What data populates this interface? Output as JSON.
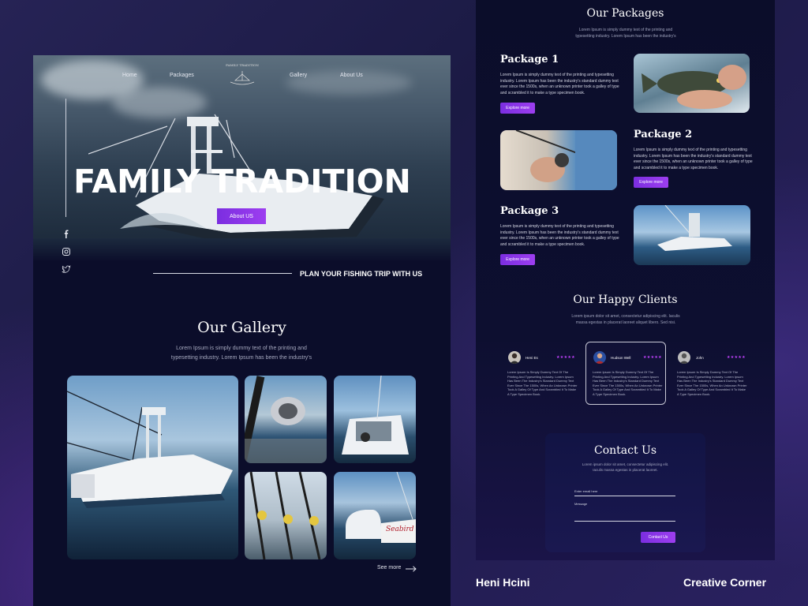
{
  "nav": {
    "home": "Home",
    "packages": "Packages",
    "gallery": "Gallery",
    "about": "About Us",
    "logo_text": "FAMILY TRADITION"
  },
  "hero": {
    "title": "FAMILY TRADITION",
    "button": "About US",
    "plan_text": "PLAN YOUR FISHING TRIP WITH US"
  },
  "social": [
    "facebook-icon",
    "instagram-icon",
    "twitter-icon"
  ],
  "gallery": {
    "title": "Our Gallery",
    "description": "Lorem Ipsum is simply dummy text of the printing and typesetting industry. Lorem Ipsum has been the industry's",
    "see_more": "See more"
  },
  "packages": {
    "title": "Our Packages",
    "subtitle": "Lorem Ipsum is simply dummy text of the printing and typesetting industry. Lorem Ipsum has been the industry's",
    "items": [
      {
        "name": "Package 1",
        "desc": "Lorem Ipsum is simply dummy text of the printing and typesetting industry. Lorem Ipsum has been the industry's standard dummy text ever since the 1500s, when an unknown printer took a galley of type and scrambled it to make a type specimen book.",
        "button": "Explore more"
      },
      {
        "name": "Package 2",
        "desc": "Lorem Ipsum is simply dummy text of the printing and typesetting industry. Lorem Ipsum has been the industry's standard dummy text ever since the 1500s, when an unknown printer took a galley of type and scrambled it to make a type specimen book.",
        "button": "Explore more"
      },
      {
        "name": "Package 3",
        "desc": "Lorem Ipsum is simply dummy text of the printing and typesetting industry. Lorem Ipsum has been the industry's standard dummy text ever since the 1500s, when an unknown printer took a galley of type and scrambled it to make a type specimen book.",
        "button": "Explore more"
      }
    ]
  },
  "clients": {
    "title": "Our Happy Clients",
    "subtitle": "Lorem ipsum dolor sit amet, consectetur adipiscing elit. Iaculis massa egestas in placerat laoreet aliquet libero. Sed nisi.",
    "items": [
      {
        "name": "Heni Es",
        "stars": "★★★★★",
        "text": "Lorem Ipsum Is Simply Dummy Text Of The Printing And Typesetting Industry. Lorem Ipsum Has Been The Industry's Standard Dummy Text Ever Since The 1500s, When An Unknown Printer Took A Galley Of Type And Scrambled It To Make A Type Specimen Book."
      },
      {
        "name": "Hudson Well",
        "stars": "★★★★★",
        "text": "Lorem Ipsum Is Simply Dummy Text Of The Printing And Typesetting Industry. Lorem Ipsum Has Been The Industry's Standard Dummy Text Ever Since The 1500s, When An Unknown Printer Took A Galley Of Type And Scrambled It To Make A Type Specimen Book."
      },
      {
        "name": "John",
        "stars": "★★★★★",
        "text": "Lorem Ipsum Is Simply Dummy Text Of The Printing And Typesetting Industry. Lorem Ipsum Has Been The Industry's Standard Dummy Text Ever Since The 1500s, When An Unknown Printer Took A Galley Of Type And Scrambled It To Make A Type Specimen Book."
      }
    ]
  },
  "contact": {
    "title": "Contact Us",
    "subtitle": "Lorem ipsum dolor sit amet, consectetur adipiscing elit. Iaculis massa egestas in placerat laoreet.",
    "email_label": "Enter email here",
    "message_label": "Message",
    "button": "Contact Us"
  },
  "footer": {
    "author": "Heni Hcini",
    "studio": "Creative Corner"
  },
  "colors": {
    "accent": "#8a35e8",
    "star": "#c342ff",
    "panel": "#0b0d2a"
  }
}
